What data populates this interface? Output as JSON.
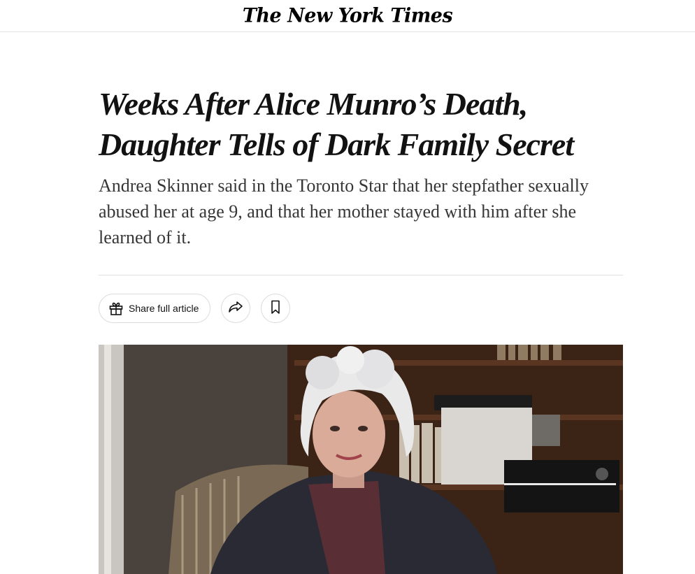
{
  "masthead": {
    "logo_text": "The New York Times"
  },
  "article": {
    "headline_line1": "Weeks After Alice Munro’s Death,",
    "headline_line2": "Daughter Tells of Dark Family Secret",
    "summary": "Andrea Skinner said in the Toronto Star that her stepfather sexually abused her at age 9, and that her mother stayed with him after she learned of it."
  },
  "toolbar": {
    "share_full_label": "Share full article",
    "gift_icon": "gift-icon",
    "share_icon": "share-arrow-icon",
    "save_icon": "bookmark-icon"
  },
  "colors": {
    "text": "#121212",
    "summary": "#363636",
    "border": "#dcdcdc"
  }
}
